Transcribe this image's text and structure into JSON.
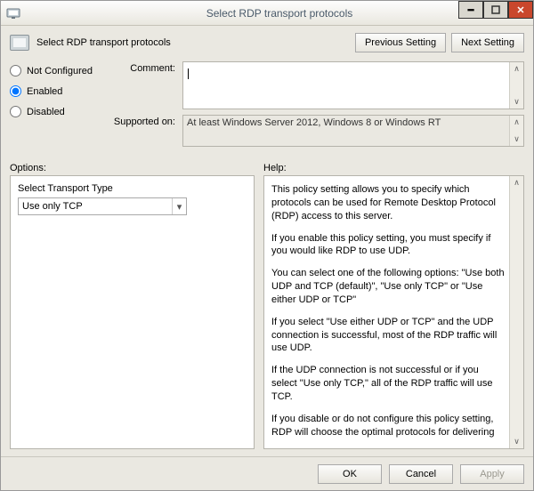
{
  "window": {
    "title": "Select RDP transport protocols",
    "minimize_tooltip": "Minimize",
    "maximize_tooltip": "Maximize",
    "close_tooltip": "Close"
  },
  "policy_row": {
    "name": "Select RDP transport protocols",
    "previous_btn": "Previous Setting",
    "next_btn": "Next Setting"
  },
  "state": {
    "not_configured_label": "Not Configured",
    "enabled_label": "Enabled",
    "disabled_label": "Disabled",
    "selected": "enabled"
  },
  "comment": {
    "label": "Comment:",
    "value": ""
  },
  "supported": {
    "label": "Supported on:",
    "value": "At least Windows Server 2012, Windows 8 or Windows RT"
  },
  "sections": {
    "options_label": "Options:",
    "help_label": "Help:"
  },
  "options": {
    "transport_label": "Select Transport Type",
    "transport_selected": "Use only TCP"
  },
  "help": {
    "p1": "This policy setting allows you to specify which protocols can be used for Remote Desktop Protocol (RDP) access to this server.",
    "p2": "If you enable this policy setting, you must specify if you would like RDP to use UDP.",
    "p3": "You can select one of the following options: \"Use both UDP and TCP (default)\", \"Use only TCP\" or \"Use either UDP or TCP\"",
    "p4": "If you select \"Use either UDP or TCP\" and the UDP connection is successful, most of the RDP traffic will use UDP.",
    "p5": "If the UDP connection is not successful or if you select \"Use only TCP,\" all of the RDP traffic will use TCP.",
    "p6": "If you disable or do not configure this policy setting, RDP will choose the optimal protocols for delivering the best user experience."
  },
  "footer": {
    "ok": "OK",
    "cancel": "Cancel",
    "apply": "Apply"
  }
}
